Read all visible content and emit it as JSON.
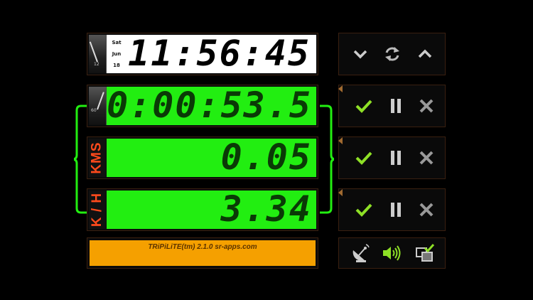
{
  "clock": {
    "day": "Sat",
    "month": "Jun",
    "date": "18",
    "time": "11:56:45"
  },
  "timer": {
    "value": "0:00:53.5"
  },
  "distance": {
    "label": "KMS",
    "value": "0.05"
  },
  "speed": {
    "label": "K / H",
    "value": "3.34"
  },
  "footer": {
    "text": "TRiPiLiTE(tm) 2.1.0 sr-apps.com"
  },
  "icons": {
    "clock_controls": [
      "chevron-down-icon",
      "refresh-icon",
      "chevron-up-icon"
    ],
    "row_controls": [
      "check-icon",
      "pause-icon",
      "close-icon"
    ],
    "bottom_controls": [
      "gps-dish-icon",
      "speaker-icon",
      "window-check-icon"
    ]
  },
  "colors": {
    "lcd_green": "#22ee11",
    "label_orange": "#ff4a1c",
    "footer_orange": "#f5a000",
    "check_green": "#8ee026"
  }
}
